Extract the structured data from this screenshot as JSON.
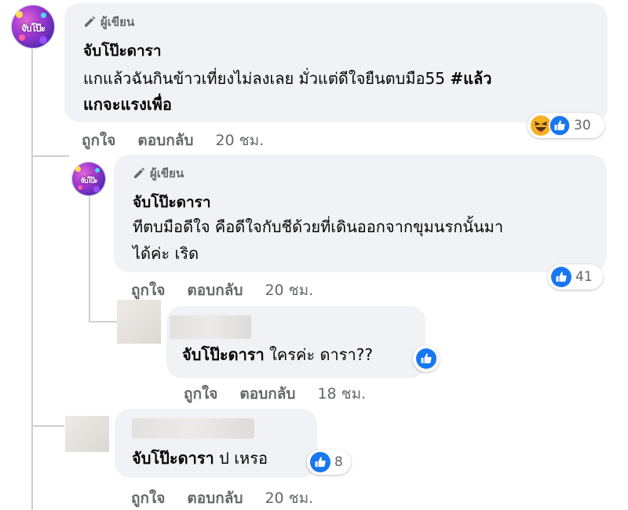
{
  "author_badge": "ผู้เขียน",
  "colors": {
    "bubble_bg": "#f0f2f5",
    "secondary_text": "#65676b",
    "like_blue": "#1877f2",
    "haha_yellow": "#f7b125"
  },
  "avatar_brand": "จับโป๊ะ",
  "comments": [
    {
      "name": "จับโป๊ะดารา",
      "line1": "แกแล้วฉันกินข้าวเที่ยงไม่ลงเลย มั่วแต่ดีใจยืนตบมือ55 ",
      "line1_bold": "#แล้ว",
      "line2_bold": "แกจะแรงเพื่อ",
      "like": "ถูกใจ",
      "reply": "ตอบกลับ",
      "time": "20 ชม.",
      "reaction_count": "30",
      "reaction_icons": [
        "haha-icon",
        "like-icon"
      ]
    },
    {
      "name": "จับโป๊ะดารา",
      "line1": "ทีตบมือดีใจ คือดีใจกับชีด้วยที่เดินออกจากขุมนรกนั้นมา",
      "line2": "ได้ค่ะ เริด",
      "like": "ถูกใจ",
      "reply": "ตอบกลับ",
      "time": "20 ชม.",
      "reaction_count": "41",
      "reaction_icons": [
        "like-icon"
      ]
    },
    {
      "name": "จับโป๊ะดารา",
      "text": " ใครค่ะ ดารา??",
      "like": "ถูกใจ",
      "reply": "ตอบกลับ",
      "time": "18 ชม.",
      "reaction_icons": [
        "like-icon"
      ]
    },
    {
      "name": "จับโป๊ะดารา",
      "text": " ป เหรอ",
      "like": "ถูกใจ",
      "reply": "ตอบกลับ",
      "time": "20 ชม.",
      "reaction_count": "8",
      "reaction_icons": [
        "like-icon"
      ]
    }
  ]
}
